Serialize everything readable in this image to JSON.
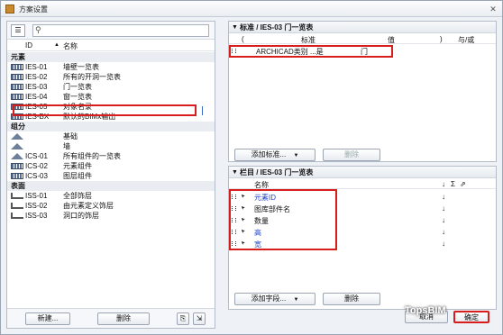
{
  "window": {
    "title": "方案设置",
    "close": "✕"
  },
  "left": {
    "columns": {
      "id": "ID",
      "name": "名称"
    },
    "groups": [
      {
        "label": "元素",
        "items": [
          {
            "id": "IES-01",
            "name": "墙壁一览表",
            "icon": "table-icon"
          },
          {
            "id": "IES-02",
            "name": "所有的开洞一览表",
            "icon": "table-icon"
          },
          {
            "id": "IES-03",
            "name": "门一览表",
            "icon": "table-icon"
          },
          {
            "id": "IES-04",
            "name": "窗一览表",
            "icon": "table-icon"
          },
          {
            "id": "IES-05",
            "name": "对象名录",
            "icon": "table-icon"
          },
          {
            "id": "IES-BX",
            "name": "默认的BIMx输出",
            "icon": "table-icon"
          }
        ]
      },
      {
        "label": "组分",
        "items": [
          {
            "id": "",
            "name": "基础",
            "icon": "component-icon"
          },
          {
            "id": "",
            "name": "墙",
            "icon": "component-icon"
          },
          {
            "id": "ICS-01",
            "name": "所有组件的一览表",
            "icon": "component-icon"
          },
          {
            "id": "ICS-02",
            "name": "元素组件",
            "icon": "table-icon"
          },
          {
            "id": "ICS-03",
            "name": "图层组件",
            "icon": "table-icon"
          }
        ]
      },
      {
        "label": "表面",
        "items": [
          {
            "id": "ISS-01",
            "name": "全部饰层",
            "icon": "surface-icon"
          },
          {
            "id": "ISS-02",
            "name": "由元素定义饰层",
            "icon": "surface-icon"
          },
          {
            "id": "ISS-03",
            "name": "洞口的饰层",
            "icon": "surface-icon"
          }
        ]
      }
    ],
    "buttons": {
      "new": "新建...",
      "delete": "删除"
    }
  },
  "criteria": {
    "header": "标准 / IES-03 门一览表",
    "cols": {
      "paren_open": "(",
      "criterion": "标准",
      "value": "值",
      "paren_close": ")",
      "andor": "与/或"
    },
    "row": {
      "criterion": "ARCHICAD类别 ...是",
      "value": "门"
    },
    "buttons": {
      "add": "添加标准...",
      "delete": "删除"
    }
  },
  "fields": {
    "header": "栏目 / IES-03 门一览表",
    "cols": {
      "name": "名称",
      "sort": "↓",
      "sum": "Σ",
      "pin": "⇗"
    },
    "rows": [
      {
        "name": "元素ID",
        "blue": true
      },
      {
        "name": "图库部件名",
        "blue": false
      },
      {
        "name": "数量",
        "blue": false
      },
      {
        "name": "高",
        "blue": true
      },
      {
        "name": "宽",
        "blue": true
      }
    ],
    "sort_mark": "↓",
    "buttons": {
      "add": "添加字段...",
      "delete": "删除"
    }
  },
  "footer": {
    "cancel": "取消",
    "ok": "确定",
    "watermark": "TopsBIM"
  }
}
